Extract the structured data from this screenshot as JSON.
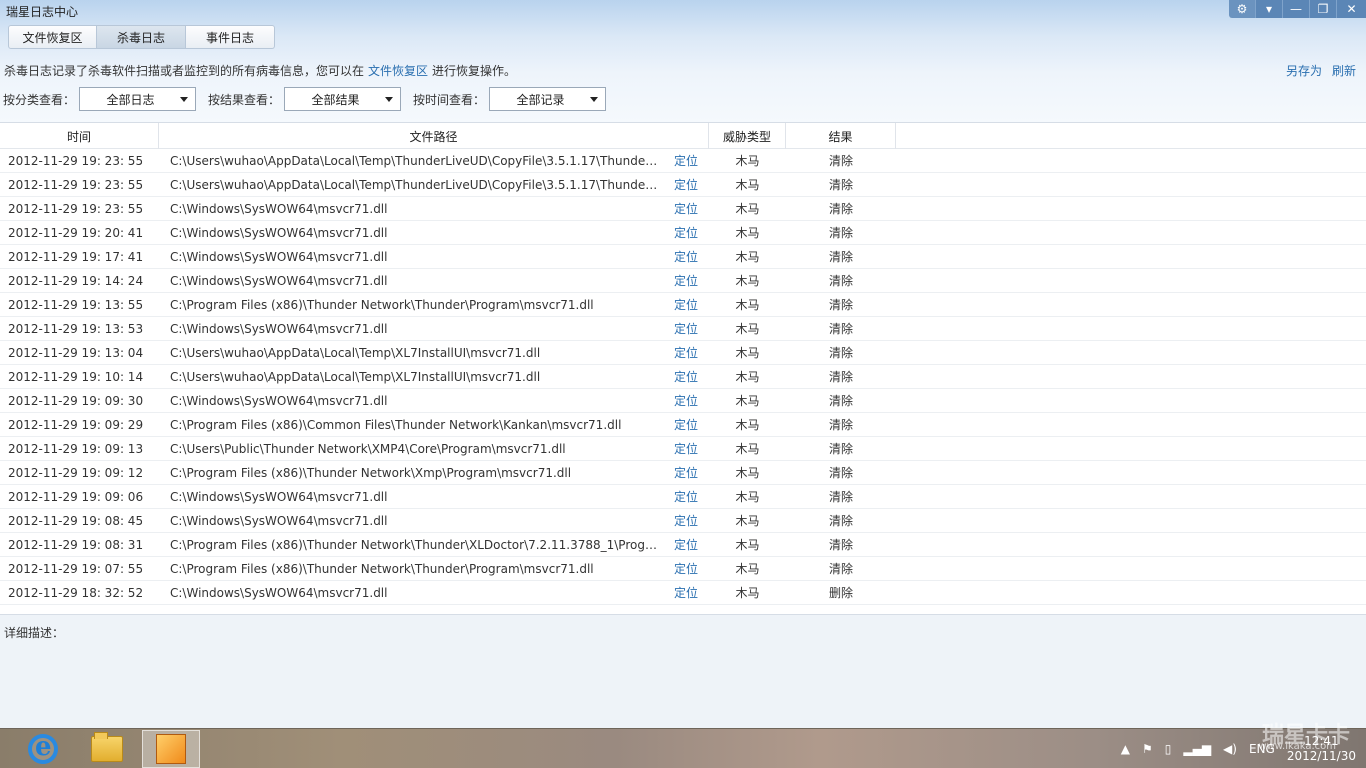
{
  "window": {
    "title": "瑞星日志中心"
  },
  "tabs": [
    {
      "label": "文件恢复区"
    },
    {
      "label": "杀毒日志"
    },
    {
      "label": "事件日志"
    }
  ],
  "description": {
    "prefix": "杀毒日志记录了杀毒软件扫描或者监控到的所有病毒信息，您可以在",
    "link": "文件恢复区",
    "suffix": "进行恢复操作。"
  },
  "actions": {
    "save_as": "另存为",
    "refresh": "刷新"
  },
  "filters": {
    "category_label": "按分类查看：",
    "category_value": "全部日志",
    "result_label": "按结果查看：",
    "result_value": "全部结果",
    "time_label": "按时间查看：",
    "time_value": "全部记录"
  },
  "table": {
    "headers": {
      "time": "时间",
      "path": "文件路径",
      "threat": "威胁类型",
      "result": "结果"
    },
    "locate_label": "定位",
    "rows": [
      {
        "time": "2012-11-29 19: 23: 55",
        "path": "C:\\Users\\wuhao\\AppData\\Local\\Temp\\ThunderLiveUD\\CopyFile\\3.5.1.17\\Thunder...",
        "threat": "木马",
        "result": "清除"
      },
      {
        "time": "2012-11-29 19: 23: 55",
        "path": "C:\\Users\\wuhao\\AppData\\Local\\Temp\\ThunderLiveUD\\CopyFile\\3.5.1.17\\Thunder...",
        "threat": "木马",
        "result": "清除"
      },
      {
        "time": "2012-11-29 19: 23: 55",
        "path": "C:\\Windows\\SysWOW64\\msvcr71.dll",
        "threat": "木马",
        "result": "清除"
      },
      {
        "time": "2012-11-29 19: 20: 41",
        "path": "C:\\Windows\\SysWOW64\\msvcr71.dll",
        "threat": "木马",
        "result": "清除"
      },
      {
        "time": "2012-11-29 19: 17: 41",
        "path": "C:\\Windows\\SysWOW64\\msvcr71.dll",
        "threat": "木马",
        "result": "清除"
      },
      {
        "time": "2012-11-29 19: 14: 24",
        "path": "C:\\Windows\\SysWOW64\\msvcr71.dll",
        "threat": "木马",
        "result": "清除"
      },
      {
        "time": "2012-11-29 19: 13: 55",
        "path": "C:\\Program Files (x86)\\Thunder Network\\Thunder\\Program\\msvcr71.dll",
        "threat": "木马",
        "result": "清除"
      },
      {
        "time": "2012-11-29 19: 13: 53",
        "path": "C:\\Windows\\SysWOW64\\msvcr71.dll",
        "threat": "木马",
        "result": "清除"
      },
      {
        "time": "2012-11-29 19: 13: 04",
        "path": "C:\\Users\\wuhao\\AppData\\Local\\Temp\\XL7InstallUI\\msvcr71.dll",
        "threat": "木马",
        "result": "清除"
      },
      {
        "time": "2012-11-29 19: 10: 14",
        "path": "C:\\Users\\wuhao\\AppData\\Local\\Temp\\XL7InstallUI\\msvcr71.dll",
        "threat": "木马",
        "result": "清除"
      },
      {
        "time": "2012-11-29 19: 09: 30",
        "path": "C:\\Windows\\SysWOW64\\msvcr71.dll",
        "threat": "木马",
        "result": "清除"
      },
      {
        "time": "2012-11-29 19: 09: 29",
        "path": "C:\\Program Files (x86)\\Common Files\\Thunder Network\\Kankan\\msvcr71.dll",
        "threat": "木马",
        "result": "清除"
      },
      {
        "time": "2012-11-29 19: 09: 13",
        "path": "C:\\Users\\Public\\Thunder Network\\XMP4\\Core\\Program\\msvcr71.dll",
        "threat": "木马",
        "result": "清除"
      },
      {
        "time": "2012-11-29 19: 09: 12",
        "path": "C:\\Program Files (x86)\\Thunder Network\\Xmp\\Program\\msvcr71.dll",
        "threat": "木马",
        "result": "清除"
      },
      {
        "time": "2012-11-29 19: 09: 06",
        "path": "C:\\Windows\\SysWOW64\\msvcr71.dll",
        "threat": "木马",
        "result": "清除"
      },
      {
        "time": "2012-11-29 19: 08: 45",
        "path": "C:\\Windows\\SysWOW64\\msvcr71.dll",
        "threat": "木马",
        "result": "清除"
      },
      {
        "time": "2012-11-29 19: 08: 31",
        "path": "C:\\Program Files (x86)\\Thunder Network\\Thunder\\XLDoctor\\7.2.11.3788_1\\Progra...",
        "threat": "木马",
        "result": "清除"
      },
      {
        "time": "2012-11-29 19: 07: 55",
        "path": "C:\\Program Files (x86)\\Thunder Network\\Thunder\\Program\\msvcr71.dll",
        "threat": "木马",
        "result": "清除"
      },
      {
        "time": "2012-11-29 18: 32: 52",
        "path": "C:\\Windows\\SysWOW64\\msvcr71.dll",
        "threat": "木马",
        "result": "删除"
      }
    ]
  },
  "detail": {
    "label": "详细描述："
  },
  "taskbar": {
    "lang": "ENG",
    "time": "12:41",
    "date": "2012/11/30",
    "watermark": "瑞星卡卡",
    "watermark_url": "www.ikaka.com"
  },
  "colors": {
    "link": "#2a6fb0",
    "header_bg": "#b9d3ee",
    "detail_bg": "#eef3f8"
  }
}
